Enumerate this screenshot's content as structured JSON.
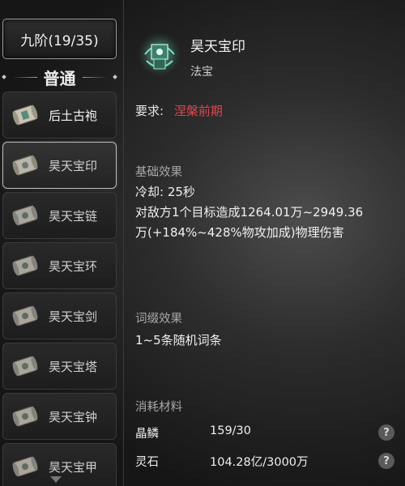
{
  "tier": {
    "label": "九阶(19/35)"
  },
  "section": {
    "label": "普通"
  },
  "items": [
    {
      "label": "后土古袍",
      "icon": "scroll-icon"
    },
    {
      "label": "昊天宝印",
      "icon": "scroll-icon"
    },
    {
      "label": "昊天宝链",
      "icon": "scroll-icon"
    },
    {
      "label": "昊天宝环",
      "icon": "scroll-icon"
    },
    {
      "label": "昊天宝剑",
      "icon": "scroll-icon"
    },
    {
      "label": "昊天宝塔",
      "icon": "scroll-icon"
    },
    {
      "label": "昊天宝钟",
      "icon": "scroll-icon"
    },
    {
      "label": "昊天宝甲",
      "icon": "scroll-icon"
    }
  ],
  "detail": {
    "name": "昊天宝印",
    "type": "法宝",
    "icon": "seal-icon",
    "requirement_label": "要求:",
    "requirement_value": "涅槃前期",
    "requirement_color": "#e0464c",
    "base_title": "基础效果",
    "cooldown": "冷却: 25秒",
    "effect_line1": "对敌方1个目标造成1264.01万~2949.36",
    "effect_line2": "万(+184%~428%物攻加成)物理伤害",
    "affix_title": "词缀效果",
    "affix_text": "1~5条随机词条",
    "materials_title": "消耗材料",
    "materials": [
      {
        "name": "晶鳞",
        "amount": "159/30",
        "help": "?"
      },
      {
        "name": "灵石",
        "amount": "104.28亿/3000万",
        "help": "?"
      }
    ]
  }
}
